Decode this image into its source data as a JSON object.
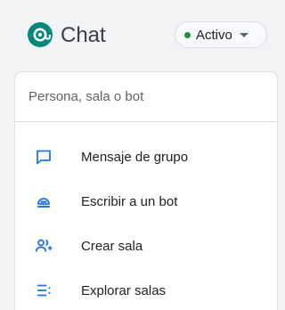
{
  "header": {
    "app_title": "Chat",
    "logo_icon": "google-chat-logo-icon",
    "status": {
      "label": "Activo",
      "color": "#1e8e3e"
    }
  },
  "search": {
    "placeholder": "Persona, sala o bot",
    "value": ""
  },
  "menu": {
    "items": [
      {
        "label": "Mensaje de grupo",
        "icon": "group-message-icon"
      },
      {
        "label": "Escribir a un bot",
        "icon": "bot-icon"
      },
      {
        "label": "Crear sala",
        "icon": "create-room-icon"
      },
      {
        "label": "Explorar salas",
        "icon": "browse-rooms-icon"
      }
    ]
  },
  "colors": {
    "accent": "#1a73e8",
    "brand": "#00897b",
    "background": "#f1f3f4"
  }
}
